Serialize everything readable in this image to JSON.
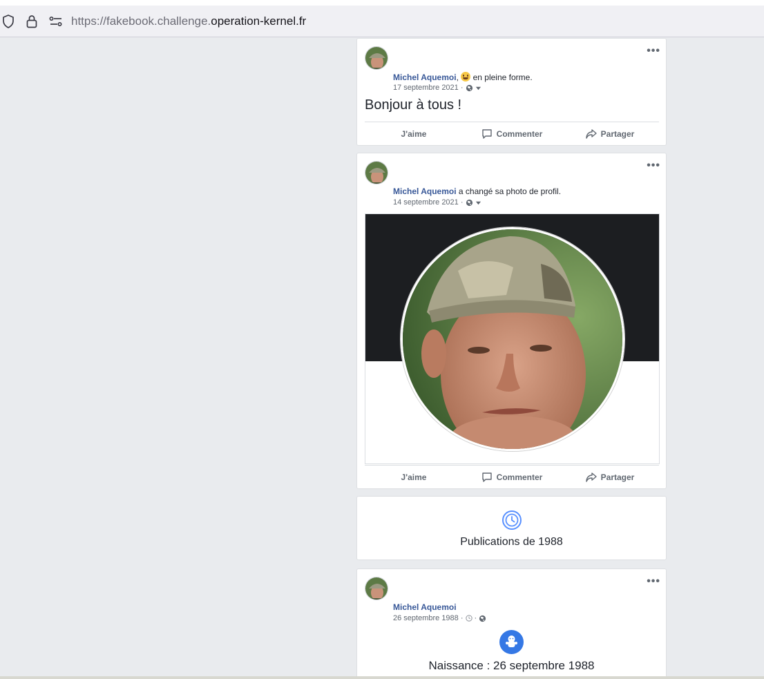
{
  "browser": {
    "url_prefix": "https://fakebook.challenge.",
    "url_host": "operation-kernel.fr"
  },
  "posts": [
    {
      "author": "Michel Aquemoi",
      "feeling_prefix": ",",
      "feeling": "en pleine forme.",
      "date": "17 septembre 2021 ·",
      "text": "Bonjour à tous !",
      "like": "J'aime",
      "comment": "Commenter",
      "share": "Partager"
    },
    {
      "author": "Michel Aquemoi",
      "action": "a changé sa photo de profil.",
      "date": "14 septembre 2021 ·",
      "like": "J'aime",
      "comment": "Commenter",
      "share": "Partager"
    }
  ],
  "year_divider": {
    "label": "Publications de 1988",
    "icon": "clock-icon",
    "accent": "#5890ff"
  },
  "life_event": {
    "author": "Michel Aquemoi",
    "date": "26 septembre 1988 ·",
    "title": "Naissance : 26 septembre 1988",
    "icon": "baby-icon",
    "accent": "#3578e5"
  },
  "colors": {
    "link": "#385898",
    "background": "#e9ebee"
  }
}
